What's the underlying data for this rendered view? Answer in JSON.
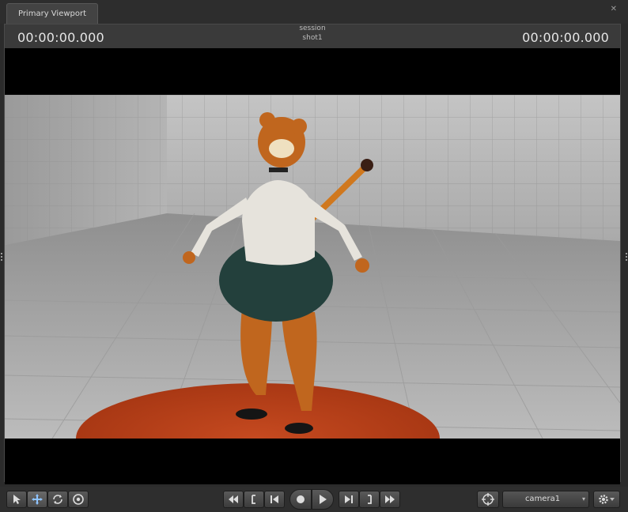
{
  "tab": {
    "label": "Primary Viewport",
    "close_icon": "close-icon"
  },
  "header": {
    "timecode_left": "00:00:00.000",
    "session_label": "session",
    "shot_label": "shot1",
    "timecode_right": "00:00:00.000"
  },
  "toolbar": {
    "left_tools": [
      "select-arrow-icon",
      "move-icon",
      "rotate-icon",
      "scale-icon"
    ],
    "transport": [
      "rewind-icon",
      "prev-marker-icon",
      "skip-to-start-icon",
      "record-icon",
      "play-icon",
      "skip-to-end-icon",
      "next-marker-icon",
      "fast-forward-icon"
    ],
    "camera_select": "camera1",
    "target_icon": "target-icon",
    "settings_icon": "gear-icon"
  },
  "colors": {
    "accent_orange": "#c0431d",
    "timecode": "#e6e6e6",
    "toolbar_bg": "#2e2e2e"
  }
}
